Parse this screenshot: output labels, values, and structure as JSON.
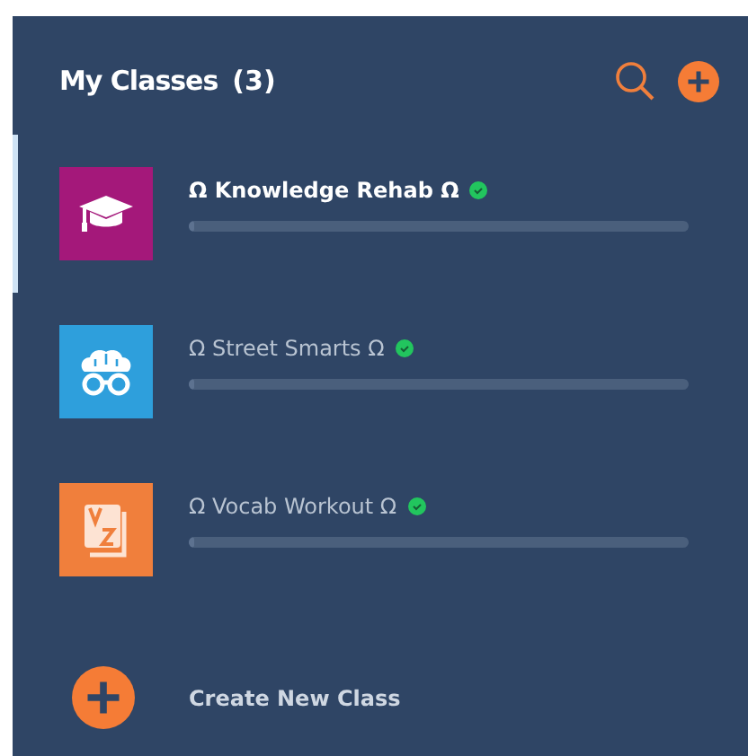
{
  "header": {
    "title": "My Classes",
    "count": "(3)"
  },
  "classes": [
    {
      "name": "Ω Knowledge Rehab Ω",
      "kind": "graduation",
      "color": "#a4187a",
      "selected": true,
      "verified": true,
      "level": 0.01
    },
    {
      "name": "Ω Street Smarts Ω",
      "kind": "brain",
      "color": "#2e9fdc",
      "selected": false,
      "verified": true,
      "level": 0
    },
    {
      "name": "Ω Vocab Workout Ω",
      "kind": "dictionary",
      "color": "#f07f3c",
      "selected": false,
      "verified": true,
      "level": 0
    }
  ],
  "create_button": {
    "label": "Create New Class"
  }
}
